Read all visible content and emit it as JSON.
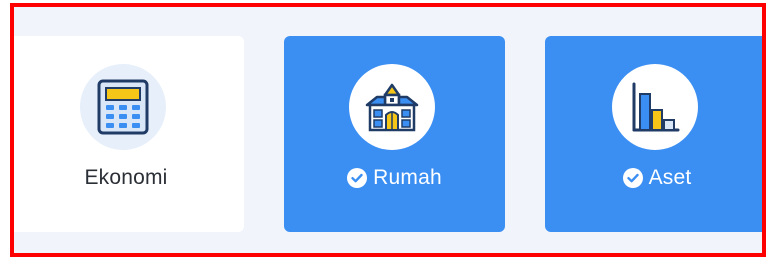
{
  "cards": [
    {
      "label": "Ekonomi",
      "icon": "calculator-icon",
      "selected": false
    },
    {
      "label": "Rumah",
      "icon": "house-icon",
      "selected": true
    },
    {
      "label": "Aset",
      "icon": "bar-chart-icon",
      "selected": true
    }
  ],
  "colors": {
    "highlight_border": "#ff0000",
    "selected_card": "#3b8ff3",
    "unselected_card": "#ffffff",
    "background": "#f1f5fb",
    "icon_dark": "#1f3b66",
    "icon_accent": "#f5c518",
    "icon_blue": "#3b8ff3"
  }
}
